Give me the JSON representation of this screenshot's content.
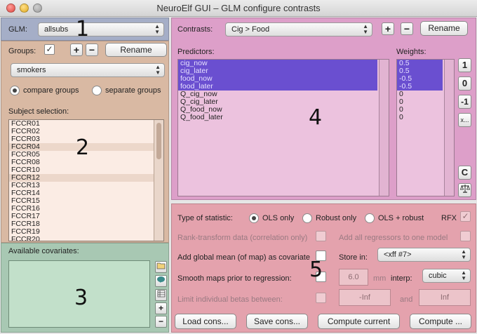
{
  "window": {
    "title": "NeuroElf GUI – GLM configure contrasts"
  },
  "glm": {
    "label": "GLM:",
    "selected": "allsubs"
  },
  "groups": {
    "label": "Groups:",
    "enabled_mark": "✓",
    "add": "+",
    "remove": "−",
    "rename": "Rename",
    "selected_group": "smokers",
    "mode_compare": "compare groups",
    "mode_separate": "separate groups",
    "mode_selected": "compare"
  },
  "subjects": {
    "label": "Subject selection:",
    "items": [
      "FCCR01",
      "FCCR02",
      "FCCR03",
      "FCCR04",
      "FCCR05",
      "FCCR08",
      "FCCR10",
      "FCCR12",
      "FCCR13",
      "FCCR14",
      "FCCR15",
      "FCCR16",
      "FCCR17",
      "FCCR18",
      "FCCR19",
      "FCCR20"
    ]
  },
  "covariates": {
    "label": "Available covariates:",
    "add": "+",
    "remove": "−"
  },
  "contrasts": {
    "label": "Contrasts:",
    "selected": "Cig > Food",
    "add": "+",
    "remove": "−",
    "rename": "Rename",
    "predictors_label": "Predictors:",
    "weights_label": "Weights:",
    "predictors": [
      "cig_now",
      "cig_later",
      "food_now",
      "food_later",
      "Q_cig_now",
      "Q_cig_later",
      "Q_food_now",
      "Q_food_later"
    ],
    "weights": [
      "0.5",
      "0.5",
      "-0.5",
      "-0.5",
      "0",
      "0",
      "0",
      "0"
    ],
    "selected_rows": 4,
    "side_buttons": [
      "1",
      "0",
      "-1",
      "x...",
      "C"
    ]
  },
  "stats": {
    "type_label": "Type of statistic:",
    "ols_only": "OLS only",
    "robust_only": "Robust only",
    "ols_robust": "OLS + robust",
    "rfx": "RFX",
    "rfx_mark": "✓",
    "rank_transform": "Rank-transform data (correlation only)",
    "add_all_regressors": "Add all regressors to one model",
    "add_global_mean": "Add global mean (of map) as covariate",
    "store_in": "Store in:",
    "store_target": "<xff #7>",
    "smooth": "Smooth maps prior to regression:",
    "smooth_value": "6.0",
    "smooth_unit": "mm",
    "interp_label": "interp:",
    "interp_value": "cubic",
    "limit_betas": "Limit individual betas between:",
    "limit_low": "-Inf",
    "limit_and": "and",
    "limit_high": "Inf"
  },
  "actions": {
    "load": "Load cons...",
    "save": "Save cons...",
    "compute_current": "Compute current",
    "compute": "Compute ..."
  },
  "overlay_numbers": [
    "1",
    "2",
    "3",
    "4",
    "5"
  ]
}
